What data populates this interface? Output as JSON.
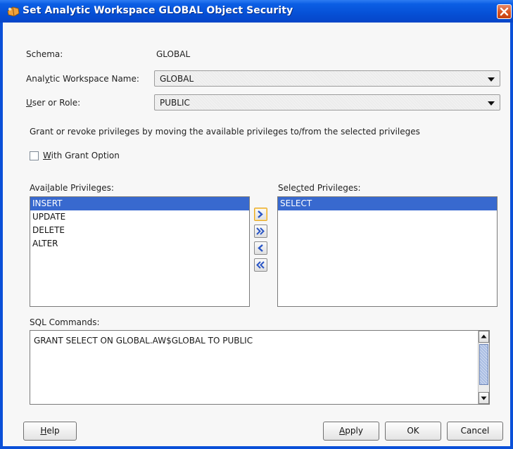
{
  "window": {
    "title": "Set Analytic Workspace GLOBAL Object Security"
  },
  "fields": {
    "schema_label": "Schema:",
    "schema_value": "GLOBAL",
    "aw_label_pre": "Anal",
    "aw_label_mn": "y",
    "aw_label_post": "tic Workspace Name:",
    "aw_value": "GLOBAL",
    "user_label_mn": "U",
    "user_label_post": "ser or Role:",
    "user_value": "PUBLIC"
  },
  "instructions": "Grant or revoke privileges by moving the available privileges to/from the selected privileges",
  "grant_option": {
    "label_mn": "W",
    "label_post": "ith Grant Option",
    "checked": false
  },
  "available": {
    "label_pre": "Avai",
    "label_mn": "l",
    "label_post": "able Privileges:",
    "items": [
      "INSERT",
      "UPDATE",
      "DELETE",
      "ALTER"
    ],
    "selected_index": 0
  },
  "selected": {
    "label_pre": "Sele",
    "label_mn": "c",
    "label_post": "ted Privileges:",
    "items": [
      "SELECT"
    ],
    "selected_index": 0
  },
  "sql": {
    "label": "SQL Commands:",
    "text": "GRANT SELECT ON GLOBAL.AW$GLOBAL TO PUBLIC"
  },
  "buttons": {
    "help_mn": "H",
    "help_post": "elp",
    "apply_mn": "A",
    "apply_post": "pply",
    "ok": "OK",
    "cancel": "Cancel"
  },
  "colors": {
    "titlebar": "#0a50d8",
    "selection": "#3869cf",
    "close": "#d9521f"
  }
}
